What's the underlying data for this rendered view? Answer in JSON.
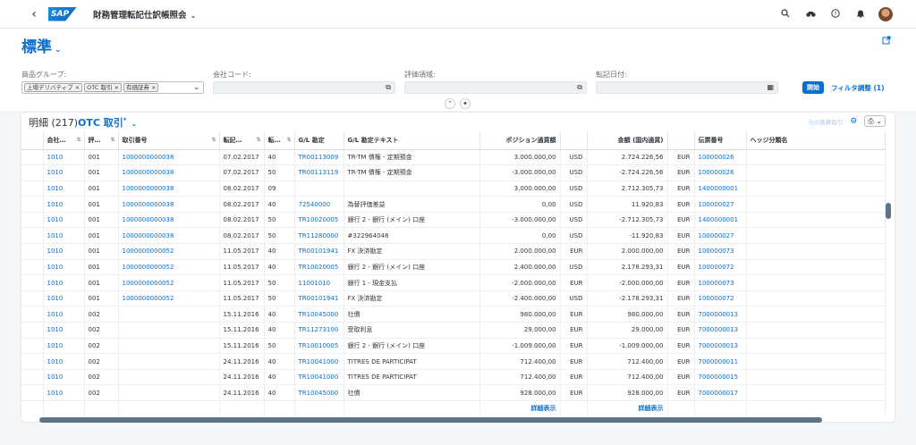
{
  "shell": {
    "back": "‹",
    "logo": "SAP",
    "app_title": "財務管理転記仕訳帳照会",
    "icons": [
      "search-icon",
      "binoculars-icon",
      "help-icon",
      "bell-icon",
      "avatar"
    ]
  },
  "header": {
    "variant": "標準",
    "filters": [
      {
        "label": "商品グループ:",
        "tokens": [
          "上場デリバティブ",
          "OTC 取引",
          "有価証券"
        ]
      },
      {
        "label": "会社コード:",
        "tokens": []
      },
      {
        "label": "評価領域:",
        "tokens": []
      },
      {
        "label": "転記日付:",
        "tokens": []
      }
    ],
    "go_label": "開始",
    "adapt_label": "フィルタ調整 (1)"
  },
  "table": {
    "title": "明細 (217)",
    "variant": "OTC 取引",
    "variant_mark": "*",
    "restore_label": "元の換算取引",
    "columns": [
      "会社…",
      "評…",
      "取引番号",
      "転記…",
      "転…",
      "G/L 勘定",
      "G/L 勘定テキスト",
      "ポジション通貨額",
      "",
      "金額 (国内通貨)",
      "",
      "伝票番号",
      "ヘッジ分類名"
    ],
    "rows": [
      [
        "1010",
        "001",
        "1000000000038",
        "07.02.2017",
        "40",
        "TR00113009",
        "TR-TM 債権 - 定期預金",
        "3.000.000,00",
        "USD",
        "2.724.226,56",
        "EUR",
        "100000026",
        ""
      ],
      [
        "1010",
        "001",
        "1000000000038",
        "07.02.2017",
        "50",
        "TR00113119",
        "TR-TM 債権 - 定期預金",
        "-3.000.000,00",
        "USD",
        "-2.724.226,56",
        "EUR",
        "100000026",
        ""
      ],
      [
        "1010",
        "001",
        "1000000000038",
        "08.02.2017",
        "09",
        "",
        "",
        "3.000.000,00",
        "USD",
        "2.712.305,73",
        "EUR",
        "1400000001",
        ""
      ],
      [
        "1010",
        "001",
        "1000000000038",
        "08.02.2017",
        "40",
        "72540000",
        "為替評価差益",
        "0,00",
        "USD",
        "11.920,83",
        "EUR",
        "100000027",
        ""
      ],
      [
        "1010",
        "001",
        "1000000000038",
        "08.02.2017",
        "50",
        "TR10020005",
        "銀行 2 - 銀行 (メイン) 口座",
        "-3.000.000,00",
        "USD",
        "-2.712.305,73",
        "EUR",
        "1400000001",
        ""
      ],
      [
        "1010",
        "001",
        "1000000000038",
        "08.02.2017",
        "50",
        "TR11280000",
        "#322964048",
        "0,00",
        "USD",
        "-11.920,83",
        "EUR",
        "100000027",
        ""
      ],
      [
        "1010",
        "001",
        "1000000000052",
        "11.05.2017",
        "40",
        "TR00101941",
        "FX 決済勘定",
        "2.000.000,00",
        "EUR",
        "2.000.000,00",
        "EUR",
        "100000073",
        ""
      ],
      [
        "1010",
        "001",
        "1000000000052",
        "11.05.2017",
        "40",
        "TR10020005",
        "銀行 2 - 銀行 (メイン) 口座",
        "2.400.000,00",
        "USD",
        "2.178.293,31",
        "EUR",
        "100000072",
        ""
      ],
      [
        "1010",
        "001",
        "1000000000052",
        "11.05.2017",
        "50",
        "11001010",
        "銀行 1 - 現金支払",
        "-2.000.000,00",
        "EUR",
        "-2.000.000,00",
        "EUR",
        "100000073",
        ""
      ],
      [
        "1010",
        "001",
        "1000000000052",
        "11.05.2017",
        "50",
        "TR00101941",
        "FX 決済勘定",
        "-2.400.000,00",
        "USD",
        "-2.178.293,31",
        "EUR",
        "100000072",
        ""
      ],
      [
        "1010",
        "002",
        "",
        "15.11.2016",
        "40",
        "TR10045000",
        "社債",
        "980.000,00",
        "EUR",
        "980.000,00",
        "EUR",
        "7000000013",
        ""
      ],
      [
        "1010",
        "002",
        "",
        "15.11.2016",
        "40",
        "TR11273100",
        "受取利息",
        "29.000,00",
        "EUR",
        "29.000,00",
        "EUR",
        "7000000013",
        ""
      ],
      [
        "1010",
        "002",
        "",
        "15.11.2016",
        "50",
        "TR10010005",
        "銀行 2 - 銀行 (メイン) 口座",
        "-1.009.000,00",
        "EUR",
        "-1.009.000,00",
        "EUR",
        "7000000013",
        ""
      ],
      [
        "1010",
        "002",
        "",
        "24.11.2016",
        "40",
        "TR10041000",
        "TITRES DE PARTICIPAT",
        "712.400,00",
        "EUR",
        "712.400,00",
        "EUR",
        "7000000011",
        ""
      ],
      [
        "1010",
        "002",
        "",
        "24.11.2016",
        "40",
        "TR10041000",
        "TITRES DE PARTICIPAT",
        "712.400,00",
        "EUR",
        "712.400,00",
        "EUR",
        "7000000015",
        ""
      ],
      [
        "1010",
        "002",
        "",
        "24.11.2016",
        "40",
        "TR10045000",
        "社債",
        "928.000,00",
        "EUR",
        "928.000,00",
        "EUR",
        "7000000017",
        ""
      ]
    ],
    "footer_link": "詳細表示"
  }
}
